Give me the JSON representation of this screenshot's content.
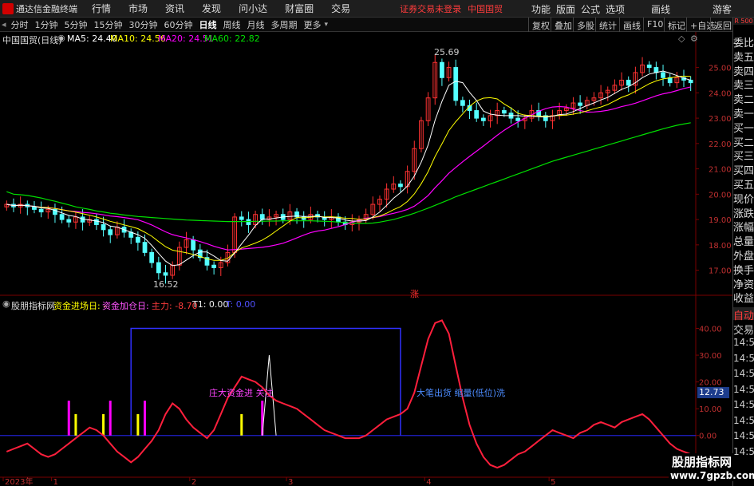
{
  "app": {
    "name": "通达信金融终端",
    "warning": "证券交易未登录",
    "stock_title": "中国国贸"
  },
  "menu": [
    "行情",
    "市场",
    "资讯",
    "发现",
    "问小达",
    "财富圈",
    "交易"
  ],
  "menu_right": [
    "功能",
    "版面",
    "公式",
    "选项",
    "画线",
    "游客"
  ],
  "periods": [
    "分时",
    "1分钟",
    "5分钟",
    "15分钟",
    "30分钟",
    "60分钟",
    "日线",
    "周线",
    "月线",
    "多周期",
    "更多"
  ],
  "active_period": "日线",
  "toolbar_right": [
    "复权",
    "叠加",
    "多股",
    "统计",
    "画线",
    "F10",
    "标记",
    "+自选",
    "返回"
  ],
  "main": {
    "title": "中国国贸(日线)",
    "ma5": "MA5: 24.40",
    "ma10": "MA10: 24.56",
    "ma20": "MA20: 24.51",
    "ma60": "MA60: 22.82",
    "high_label": "25.69",
    "low_label": "16.52",
    "rise_tag": "涨",
    "ma_colors": {
      "ma5": "#ffffff",
      "ma10": "#ffff00",
      "ma20": "#ff00ff",
      "ma60": "#00e000"
    }
  },
  "axis": {
    "price_ticks": [
      "25.00",
      "24.00",
      "23.00",
      "22.00",
      "21.00",
      "20.00",
      "19.00",
      "18.00",
      "17.00"
    ],
    "ind_ticks": [
      "40.00",
      "30.00",
      "20.00",
      "10.00",
      "0.00",
      "-10.00"
    ],
    "current_value": "12.73",
    "x_labels": [
      "2023年",
      "1",
      "2",
      "3",
      "4",
      "5"
    ]
  },
  "sidebar": {
    "top": "R 500",
    "order_book": [
      "委比",
      "卖五",
      "卖四",
      "卖三",
      "卖二",
      "卖一",
      "买一",
      "买二",
      "买三",
      "买四",
      "买五",
      "现价",
      "涨跌",
      "涨幅",
      "总量",
      "外盘",
      "换手",
      "净资",
      "收益"
    ],
    "auto_label": "自动",
    "trade_label": "交易",
    "times": [
      "14:56",
      "14:56",
      "14:56",
      "14:56",
      "14:56",
      "14:56",
      "14:56",
      "14:56"
    ]
  },
  "indicator": {
    "name": "股朋指标网",
    "l1": "资金进场日: -",
    "l2": "资金加仓日: -",
    "l3": "主力: -8.70",
    "l4": "T1: 0.00",
    "l5": "T: 0.00",
    "annotation1": "庄大资金进 关注",
    "annotation2": "大笔出货 缩量(低位)洗"
  },
  "watermark": {
    "line1": "股朋指标网",
    "line2": "www.7gpzb.com"
  },
  "chart_data": {
    "type": "line",
    "subtype": "candlestick_with_indicator",
    "price_axis": {
      "ylim": [
        16.2,
        25.9
      ],
      "ticks": [
        17,
        18,
        19,
        20,
        21,
        22,
        23,
        24,
        25
      ]
    },
    "indicator_axis": {
      "ylim": [
        -12,
        47
      ],
      "ticks": [
        -10,
        0,
        10,
        20,
        30,
        40
      ]
    },
    "x_axis": {
      "labels": [
        "2023年",
        "1",
        "2",
        "3",
        "4",
        "5"
      ]
    },
    "key_points": {
      "high": 25.69,
      "low": 16.52
    },
    "ma5_last": 24.4,
    "ma10_last": 24.56,
    "ma20_last": 24.51,
    "ma60_last": 22.82,
    "close": [
      19.6,
      19.5,
      19.6,
      19.5,
      19.4,
      19.3,
      19.4,
      19.2,
      19.0,
      18.9,
      19.1,
      18.9,
      19.0,
      18.8,
      18.6,
      18.4,
      18.7,
      18.5,
      18.3,
      18.1,
      17.7,
      17.3,
      16.9,
      16.8,
      17.2,
      17.9,
      18.2,
      17.8,
      17.5,
      17.2,
      17.1,
      17.3,
      17.7,
      19.1,
      19.0,
      18.8,
      19.2,
      19.0,
      19.1,
      19.2,
      19.0,
      19.3,
      19.1,
      19.0,
      19.2,
      19.1,
      19.0,
      19.1,
      18.9,
      18.8,
      18.9,
      19.0,
      19.2,
      19.6,
      19.8,
      20.2,
      20.4,
      20.3,
      20.9,
      21.8,
      22.9,
      23.8,
      25.2,
      24.6,
      25.0,
      23.7,
      23.5,
      23.3,
      23.0,
      22.9,
      23.1,
      23.3,
      23.2,
      23.0,
      22.9,
      23.0,
      23.3,
      23.1,
      22.9,
      23.1,
      23.3,
      23.4,
      23.6,
      23.5,
      23.7,
      23.8,
      24.0,
      24.1,
      24.3,
      24.5,
      24.3,
      24.8,
      25.1,
      25.0,
      24.8,
      24.6,
      24.4,
      24.6,
      24.5,
      24.4
    ],
    "ma_last": {
      "ma5": 24.4,
      "ma10": 24.56,
      "ma20": 24.51,
      "ma60": 22.82
    },
    "ma60": [
      20.1,
      20.0,
      19.98,
      19.95,
      19.9,
      19.85,
      19.78,
      19.72,
      19.65,
      19.58,
      19.5,
      19.45,
      19.4,
      19.34,
      19.3,
      19.25,
      19.22,
      19.18,
      19.15,
      19.12,
      19.1,
      19.08,
      19.06,
      19.04,
      19.02,
      19.0,
      18.98,
      18.97,
      18.96,
      18.95,
      18.94,
      18.93,
      18.92,
      18.92,
      18.92,
      18.92,
      18.93,
      18.93,
      18.94,
      18.94,
      18.95,
      18.95,
      18.95,
      18.95,
      18.95,
      18.94,
      18.93,
      18.92,
      18.9,
      18.88,
      18.86,
      18.85,
      18.85,
      18.86,
      18.9,
      18.95,
      19.0,
      19.08,
      19.16,
      19.25,
      19.35,
      19.45,
      19.56,
      19.67,
      19.78,
      19.9,
      20.0,
      20.1,
      20.2,
      20.3,
      20.4,
      20.5,
      20.6,
      20.7,
      20.8,
      20.9,
      21.0,
      21.1,
      21.2,
      21.3,
      21.38,
      21.46,
      21.54,
      21.62,
      21.7,
      21.78,
      21.86,
      21.94,
      22.02,
      22.1,
      22.18,
      22.26,
      22.34,
      22.42,
      22.5,
      22.58,
      22.65,
      22.72,
      22.77,
      22.82
    ],
    "ind_main": [
      -6,
      -5,
      -4,
      -3,
      -5,
      -7,
      -8,
      -7,
      -5,
      -3,
      -1,
      1,
      3,
      2,
      0,
      -3,
      -6,
      -8,
      -10,
      -8,
      -5,
      -2,
      2,
      8,
      12,
      10,
      6,
      3,
      1,
      -1,
      2,
      8,
      14,
      18,
      22,
      21,
      20,
      18,
      15,
      13,
      12,
      11,
      10,
      8,
      6,
      4,
      2,
      1,
      0,
      -1,
      -1,
      -1,
      0,
      2,
      4,
      6,
      7,
      8,
      10,
      16,
      26,
      36,
      42,
      43,
      38,
      26,
      14,
      4,
      -3,
      -8,
      -11,
      -12,
      -11,
      -9,
      -7,
      -6,
      -4,
      -2,
      0,
      2,
      1,
      0,
      -1,
      1,
      2,
      4,
      5,
      4,
      3,
      5,
      6,
      7,
      8,
      6,
      3,
      0,
      -3,
      -5,
      -6,
      -7
    ],
    "funds_entry_window": {
      "start_index": 18,
      "end_index": 57,
      "value": 40
    },
    "spike_T1": {
      "index": 38,
      "value": 30
    }
  }
}
